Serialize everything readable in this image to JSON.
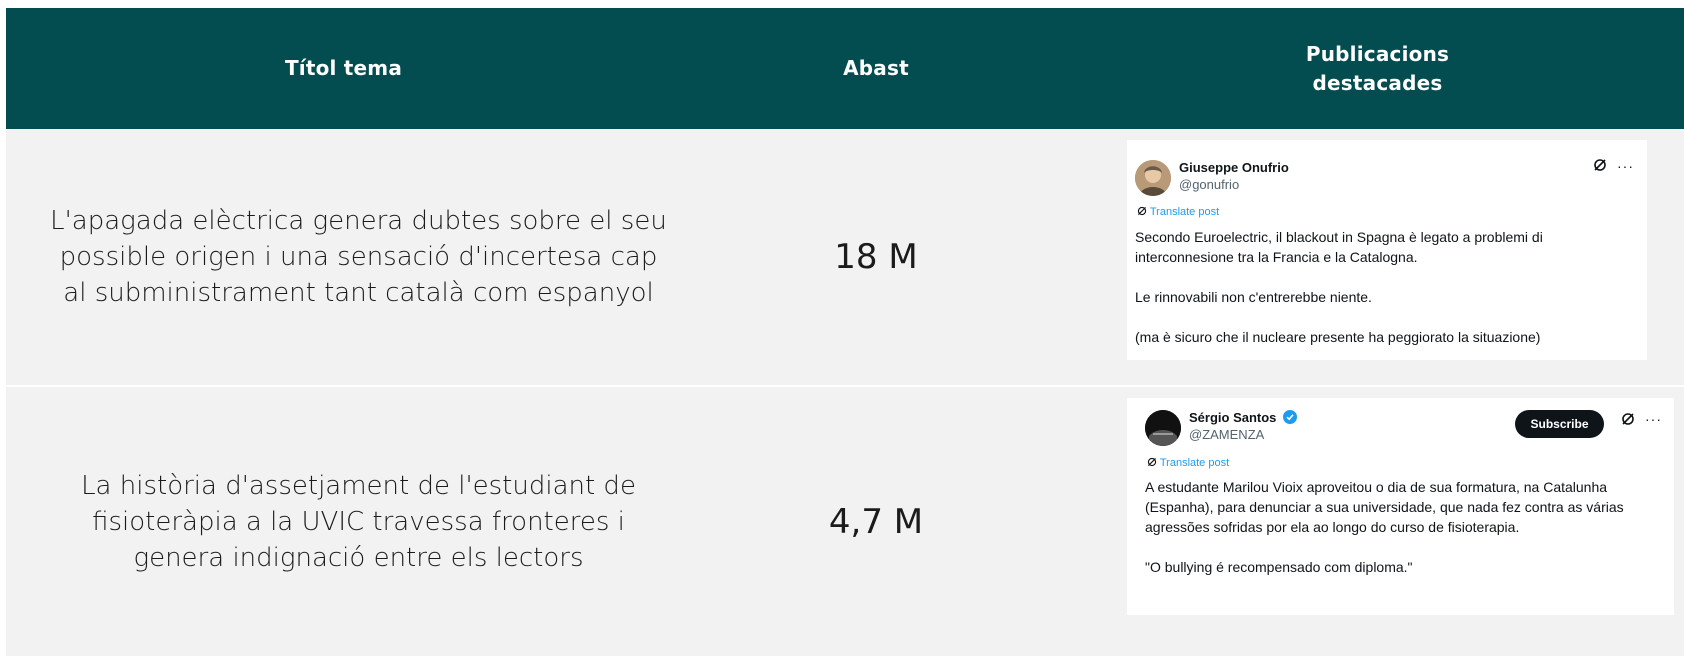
{
  "header": {
    "col1": "Títol tema",
    "col2": "Abast",
    "col3_line1": "Publicacions",
    "col3_line2": "destacades"
  },
  "rows": [
    {
      "title": "L'apagada elèctrica genera dubtes sobre el seu possible origen i una sensació d'incertesa cap al subministrament tant català com espanyol",
      "reach": "18 M",
      "post": {
        "name": "Giuseppe Onufrio",
        "handle": "@gonufrio",
        "translate": "Translate post",
        "text": "Secondo Euroelectric, il blackout in Spagna è legato a problemi di interconnesione tra la Francia e la Catalogna.\n\nLe rinnovabili non c'entrerebbe niente.\n\n(ma è sicuro che il nucleare presente ha peggiorato la situazione)"
      }
    },
    {
      "title": "La història d'assetjament de l'estudiant de fisioteràpia a la UVIC travessa fronteres i genera indignació entre els lectors",
      "reach": "4,7 M",
      "post": {
        "name": "Sérgio Santos",
        "handle": "@ZAMENZA",
        "subscribe": "Subscribe",
        "translate": "Translate post",
        "text": "A estudante Marilou Vioix aproveitou o dia de sua formatura, na Catalunha (Espanha), para denunciar a sua universidade, que nada fez contra as várias agressões sofridas por ela ao longo do curso de fisioterapia.\n\n\"O bullying é recompensado com diploma.\""
      }
    }
  ],
  "colors": {
    "header_bg": "#034c4f",
    "row_bg": "#f2f2f2",
    "link_blue": "#1d9bf0"
  }
}
